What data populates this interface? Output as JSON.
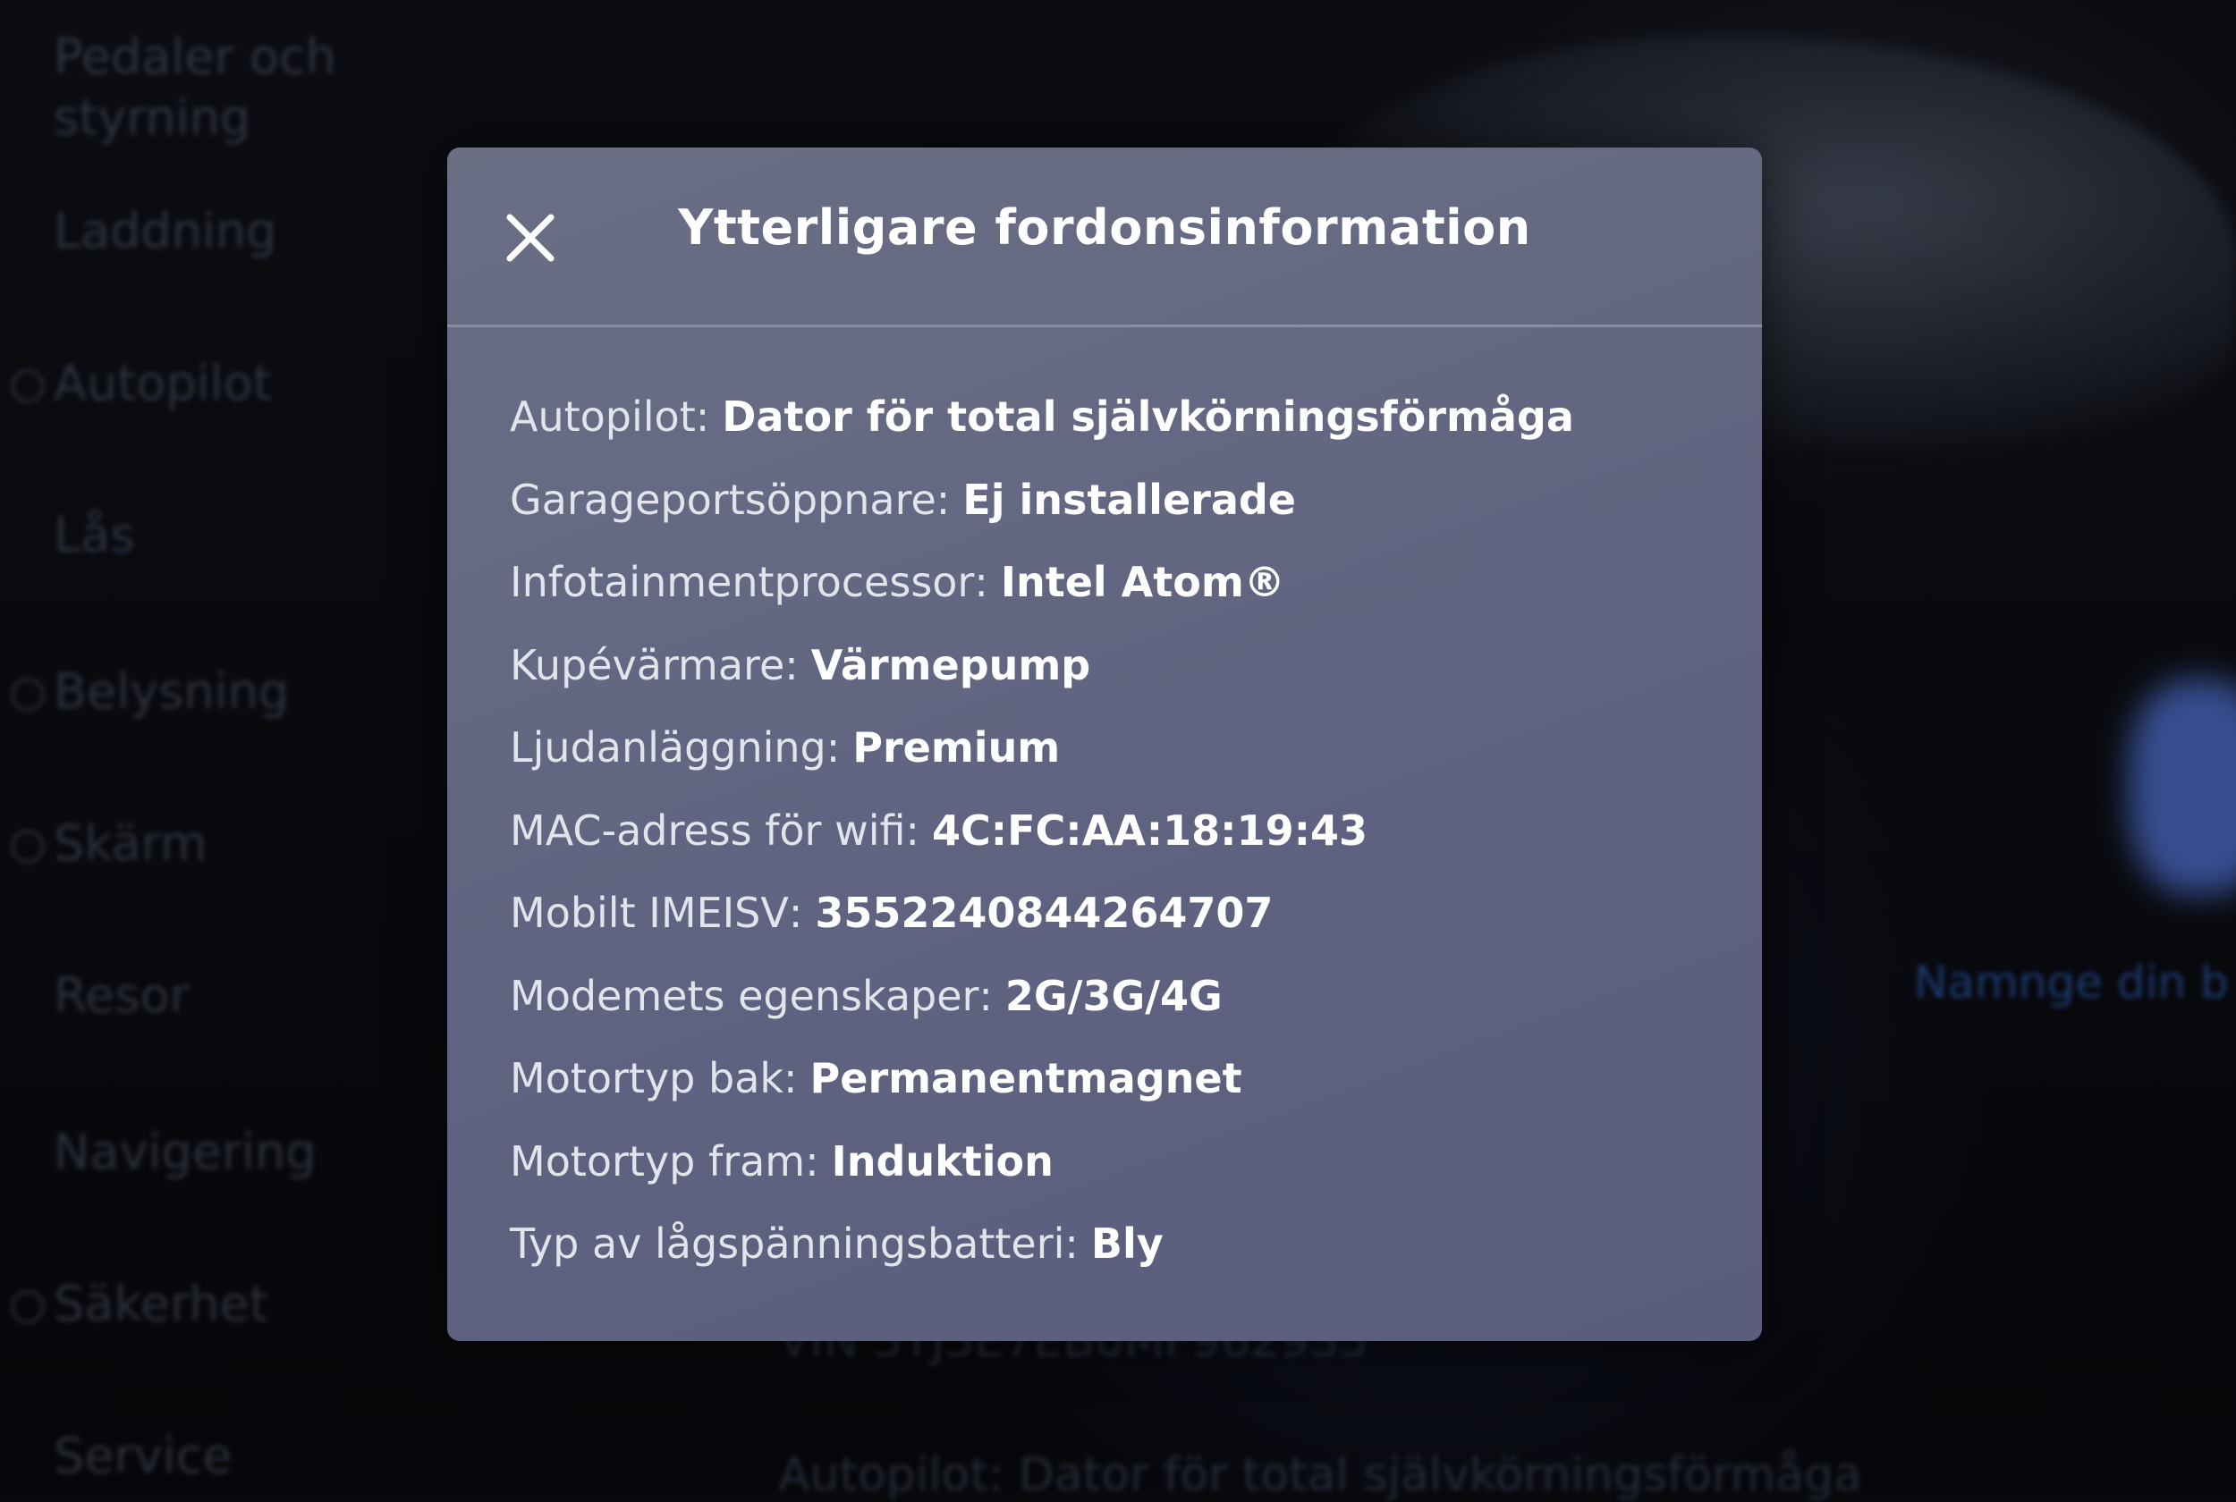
{
  "sidebar": {
    "items": [
      {
        "label": "Pedaler och styrning",
        "line2": "styrning",
        "line1": "Pedaler och"
      },
      {
        "label": "Laddning"
      },
      {
        "label": "Autopilot"
      },
      {
        "label": "Lås"
      },
      {
        "label": "Belysning"
      },
      {
        "label": "Skärm"
      },
      {
        "label": "Resor"
      },
      {
        "label": "Navigering"
      },
      {
        "label": "Säkerhet"
      },
      {
        "label": "Service"
      }
    ]
  },
  "background": {
    "vin_text": "VIN 5YJ3E7EB0MF962935",
    "autopilot_text": "Autopilot: Dator för total självkörningsförmåga",
    "name_link": "Namnge din b"
  },
  "modal": {
    "title": "Ytterligare fordonsinformation",
    "close_icon": "close-icon",
    "rows": [
      {
        "label": "Autopilot",
        "value": "Dator för total självkörningsförmåga"
      },
      {
        "label": "Garageportsöppnare",
        "value": "Ej installerade"
      },
      {
        "label": "Infotainmentprocessor",
        "value": "Intel Atom®"
      },
      {
        "label": "Kupévärmare",
        "value": "Värmepump"
      },
      {
        "label": "Ljudanläggning",
        "value": "Premium"
      },
      {
        "label": "MAC-adress för wifi",
        "value": "4C:FC:AA:18:19:43"
      },
      {
        "label": "Mobilt IMEISV",
        "value": "3552240844264707"
      },
      {
        "label": "Modemets egenskaper",
        "value": "2G/3G/4G"
      },
      {
        "label": "Motortyp bak",
        "value": "Permanentmagnet"
      },
      {
        "label": "Motortyp fram",
        "value": "Induktion"
      },
      {
        "label": "Typ av lågspänningsbatteri",
        "value": "Bly"
      }
    ]
  },
  "colors": {
    "modal_bg": "#6b6f84",
    "page_bg": "#07090c",
    "text": "#ffffff"
  }
}
